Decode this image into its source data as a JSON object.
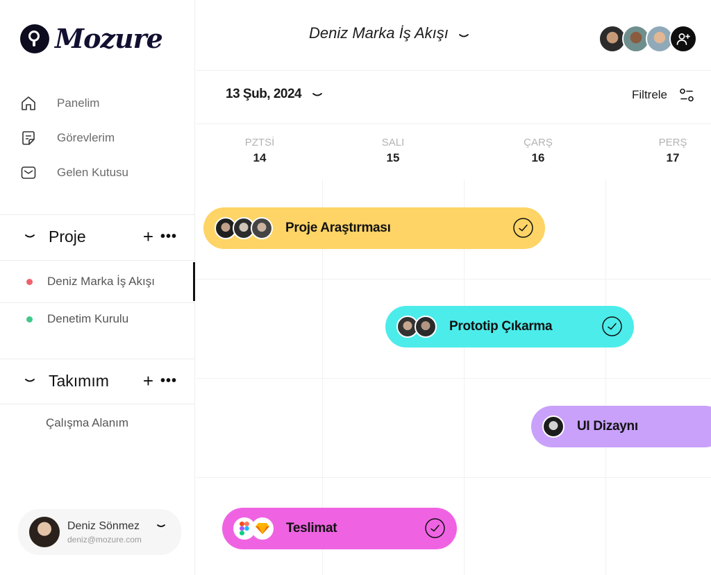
{
  "app": {
    "name": "Mozure"
  },
  "nav": [
    {
      "label": "Panelim",
      "icon": "home-icon"
    },
    {
      "label": "Görevlerim",
      "icon": "note-icon"
    },
    {
      "label": "Gelen Kutusu",
      "icon": "inbox-icon"
    }
  ],
  "projects": {
    "title": "Proje",
    "items": [
      {
        "label": "Deniz Marka İş Akışı",
        "color": "#f0616c",
        "active": true
      },
      {
        "label": "Denetim Kurulu",
        "color": "#41c98a",
        "active": false
      }
    ]
  },
  "team": {
    "title": "Takımım",
    "items": [
      {
        "label": "Çalışma Alanım"
      }
    ]
  },
  "user": {
    "name": "Deniz Sönmez",
    "email": "deniz@mozure.com"
  },
  "header": {
    "workflow_title": "Deniz Marka İş Akışı"
  },
  "toolbar": {
    "date": "13 Şub, 2024",
    "filter_label": "Filtrele"
  },
  "days": [
    {
      "name": "PZTSİ",
      "date": "14"
    },
    {
      "name": "SALI",
      "date": "15"
    },
    {
      "name": "ÇARŞ",
      "date": "16"
    },
    {
      "name": "PERŞ",
      "date": "17"
    }
  ],
  "tasks": [
    {
      "name": "Proje Araştırması",
      "color": "#fdd465",
      "assignees": 3,
      "done": true
    },
    {
      "name": "Prototip Çıkarma",
      "color": "#4cecea",
      "assignees": 2,
      "done": true
    },
    {
      "name": "UI Dizaynı",
      "color": "#c9a1fb",
      "assignees": 1,
      "done": false
    },
    {
      "name": "Teslimat",
      "color": "#ef63e3",
      "assignees": 2,
      "tools": [
        "figma-icon",
        "sketch-icon"
      ],
      "done": true
    }
  ]
}
